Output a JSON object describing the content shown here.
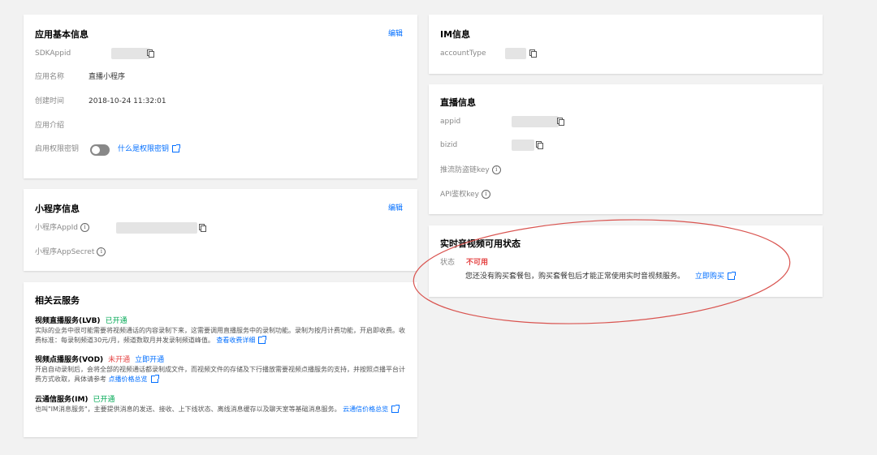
{
  "app_info": {
    "title": "应用基本信息",
    "edit": "编辑",
    "sdkappid_label": "SDKAppid",
    "name_label": "应用名称",
    "name_value": "直播小程序",
    "created_label": "创建时间",
    "created_value": "2018-10-24 11:32:01",
    "intro_label": "应用介绍",
    "perm_label": "启用权限密钥",
    "perm_link": "什么是权限密钥"
  },
  "miniprogram": {
    "title": "小程序信息",
    "edit": "编辑",
    "appid_label": "小程序AppId",
    "secret_label": "小程序AppSecret"
  },
  "cloud_services": {
    "title": "相关云服务",
    "items": [
      {
        "name": "视频直播服务(LVB)",
        "status": "已开通",
        "action": "",
        "desc": "实际的业务中很可能需要将视频通话的内容录制下来，这需要调用直播服务中的录制功能。录制为按月计费功能，开启即收费。收费标准：每录制频道30元/月，频道数取月并发录制频道峰值。",
        "link": "查看收费详细"
      },
      {
        "name": "视频点播服务(VOD)",
        "status": "未开通",
        "action": "立即开通",
        "desc": "开启自动录制后，会将全部的视频通话都录制成文件，而视频文件的存储及下行播放需要视频点播服务的支持，并按照点播平台计费方式收取，具体请参考",
        "link": "点播价格总览"
      },
      {
        "name": "云通信服务(IM)",
        "status": "已开通",
        "action": "",
        "desc": "也叫\"IM消息服务\"，主要提供消息的发送、接收、上下线状态、离线消息缓存以及聊天室等基础消息服务。",
        "link": "云通信价格总览"
      }
    ]
  },
  "im_info": {
    "title": "IM信息",
    "account_label": "accountType"
  },
  "live_info": {
    "title": "直播信息",
    "appid_label": "appid",
    "bizid_label": "bizid",
    "push_key_label": "推流防盗链key",
    "api_key_label": "API鉴权key"
  },
  "rtc_status": {
    "title": "实时音视频可用状态",
    "state_label": "状态",
    "state_value": "不可用",
    "message": "您还没有购买套餐包，购买套餐包后才能正常使用实时音视频服务。",
    "buy_link": "立即购买"
  },
  "colors": {
    "accent": "#006eff",
    "danger": "#e54545",
    "success": "#00a854",
    "annotation": "#d9534f"
  }
}
